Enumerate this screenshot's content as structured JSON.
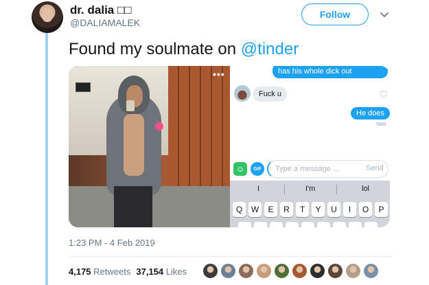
{
  "tweet": {
    "display_name": "dr. dalia □□",
    "handle": "@DALIAMALEK",
    "follow_label": "Follow",
    "text_prefix": "Found my soulmate on ",
    "mention": "@tinder",
    "timestamp": "1:23 PM - 4 Feb 2019",
    "retweets_count": "4,175",
    "retweets_label": "Retweets",
    "likes_count": "37,154",
    "likes_label": "Likes"
  },
  "media": {
    "more_label": "•••",
    "chat": {
      "top_message": "has his whole dick out",
      "reply_message": "Fuck u",
      "sent_message": "He does",
      "sent_status": "Sent",
      "gif_label": "GIF",
      "input_placeholder": "Type a message ...",
      "send_label": "Send",
      "suggestions": [
        "I",
        "I'm",
        "lol"
      ],
      "keyboard_row": [
        "Q",
        "W",
        "E",
        "R",
        "T",
        "Y",
        "U",
        "I",
        "O",
        "P"
      ]
    }
  },
  "likers_colors": [
    "#3b3b3b",
    "#6b7f96",
    "#8a6d5a",
    "#c79c7a",
    "#4f6e3a",
    "#a45a2f",
    "#2d2d2d",
    "#5c4636",
    "#b4a08a",
    "#7a8fa8"
  ],
  "colors": {
    "accent": "#1da1f2",
    "text_primary": "#14171a",
    "text_secondary": "#657786"
  }
}
